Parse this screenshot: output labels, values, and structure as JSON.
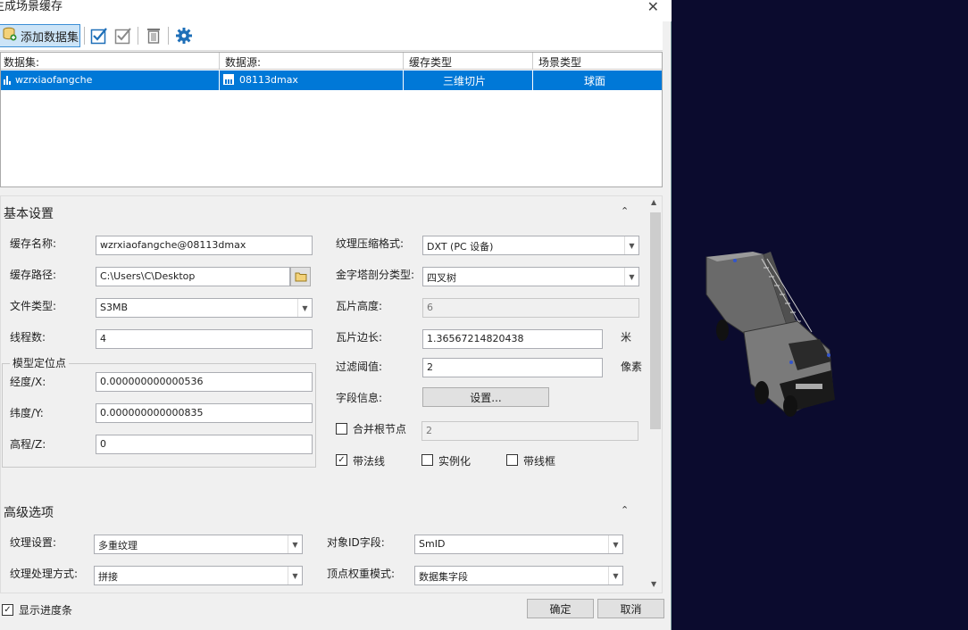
{
  "title": "生成场景缓存",
  "toolbar": {
    "add_dataset_label": "添加数据集",
    "icons": [
      "database-icon",
      "check-all-icon",
      "uncheck-all-icon",
      "delete-icon",
      "settings-icon"
    ]
  },
  "grid": {
    "headers": [
      "数据集:",
      "数据源:",
      "缓存类型",
      "场景类型"
    ],
    "rows": [
      {
        "dataset": "wzrxiaofangche",
        "datasource": "08113dmax",
        "cache_type": "三维切片",
        "scene_type": "球面"
      }
    ]
  },
  "basic": {
    "title": "基本设置",
    "cache_name_label": "缓存名称:",
    "cache_name_value": "wzrxiaofangche@08113dmax",
    "cache_path_label": "缓存路径:",
    "cache_path_value": "C:\\Users\\C\\Desktop",
    "file_type_label": "文件类型:",
    "file_type_value": "S3MB",
    "threads_label": "线程数:",
    "threads_value": "4",
    "model_group_label": "模型定位点",
    "lon_label": "经度/X:",
    "lon_value": "0.000000000000536",
    "lat_label": "纬度/Y:",
    "lat_value": "0.000000000000835",
    "elev_label": "高程/Z:",
    "elev_value": "0",
    "texture_compress_label": "纹理压缩格式:",
    "texture_compress_value": "DXT (PC 设备)",
    "pyramid_label": "金字塔剖分类型:",
    "pyramid_value": "四叉树",
    "tile_height_label": "瓦片高度:",
    "tile_height_value": "6",
    "tile_side_label": "瓦片边长:",
    "tile_side_value": "1.36567214820438",
    "tile_side_unit": "米",
    "filter_label": "过滤阈值:",
    "filter_value": "2",
    "filter_unit": "像素",
    "field_info_label": "字段信息:",
    "field_info_button": "设置...",
    "merge_root_label": "合并根节点",
    "merge_root_value": "2",
    "merge_root_checked": false,
    "normal_label": "带法线",
    "normal_checked": true,
    "instance_label": "实例化",
    "instance_checked": false,
    "wireframe_label": "带线框",
    "wireframe_checked": false
  },
  "advanced": {
    "title": "高级选项",
    "texture_setting_label": "纹理设置:",
    "texture_setting_value": "多重纹理",
    "texture_process_label": "纹理处理方式:",
    "texture_process_value": "拼接",
    "object_id_label": "对象ID字段:",
    "object_id_value": "SmID",
    "vertex_weight_label": "顶点权重模式:",
    "vertex_weight_value": "数据集字段"
  },
  "footer": {
    "show_progress_label": "显示进度条",
    "show_progress_checked": true,
    "ok_label": "确定",
    "cancel_label": "取消"
  },
  "colors": {
    "selection": "#0078d7",
    "viewport_bg": "#0b0b2e",
    "accent_icon": "#1e6fb8"
  }
}
